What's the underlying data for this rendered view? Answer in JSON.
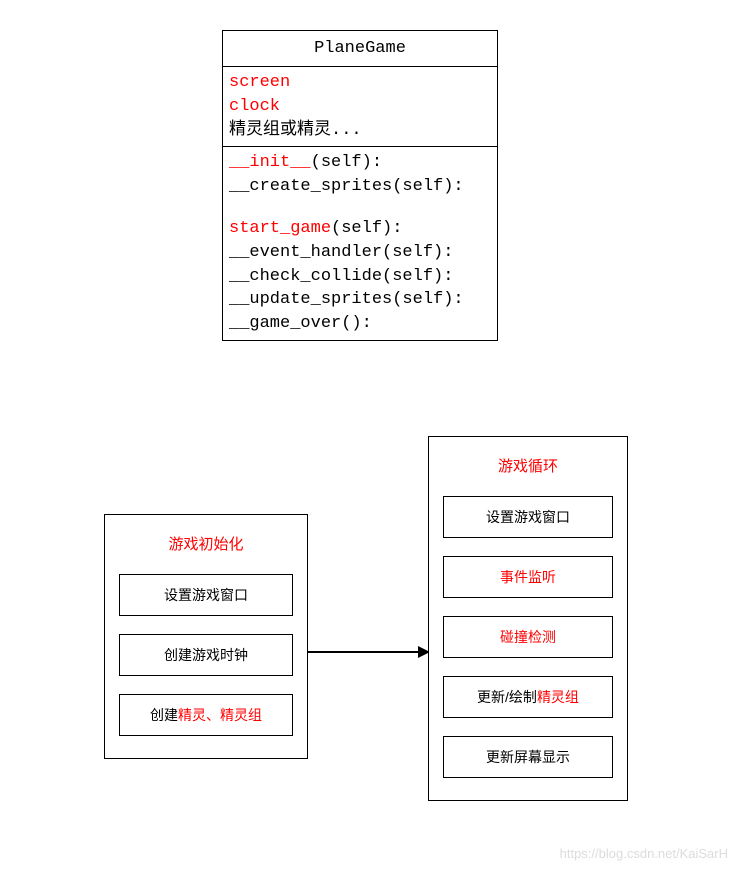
{
  "uml": {
    "title": "PlaneGame",
    "attrs": {
      "screen": "screen",
      "clock": "clock",
      "sprites": "精灵组或精灵..."
    },
    "methods": {
      "init_red": "__init__",
      "init_rest": "(self):",
      "create_sprites": "__create_sprites(self):",
      "start_red": "start_game",
      "start_rest": "(self):",
      "event_handler": "__event_handler(self):",
      "check_collide": "__check_collide(self):",
      "update_sprites": "__update_sprites(self):",
      "game_over": "__game_over():"
    }
  },
  "left": {
    "title": "游戏初始化",
    "item1": "设置游戏窗口",
    "item2": "创建游戏时钟",
    "item3_a": "创建",
    "item3_b": "精灵、精灵组"
  },
  "right": {
    "title": "游戏循环",
    "item1": "设置游戏窗口",
    "item2": "事件监听",
    "item3": "碰撞检测",
    "item4_a": "更新/绘制",
    "item4_b": "精灵组",
    "item5": "更新屏幕显示"
  },
  "watermark": "https://blog.csdn.net/KaiSarH"
}
